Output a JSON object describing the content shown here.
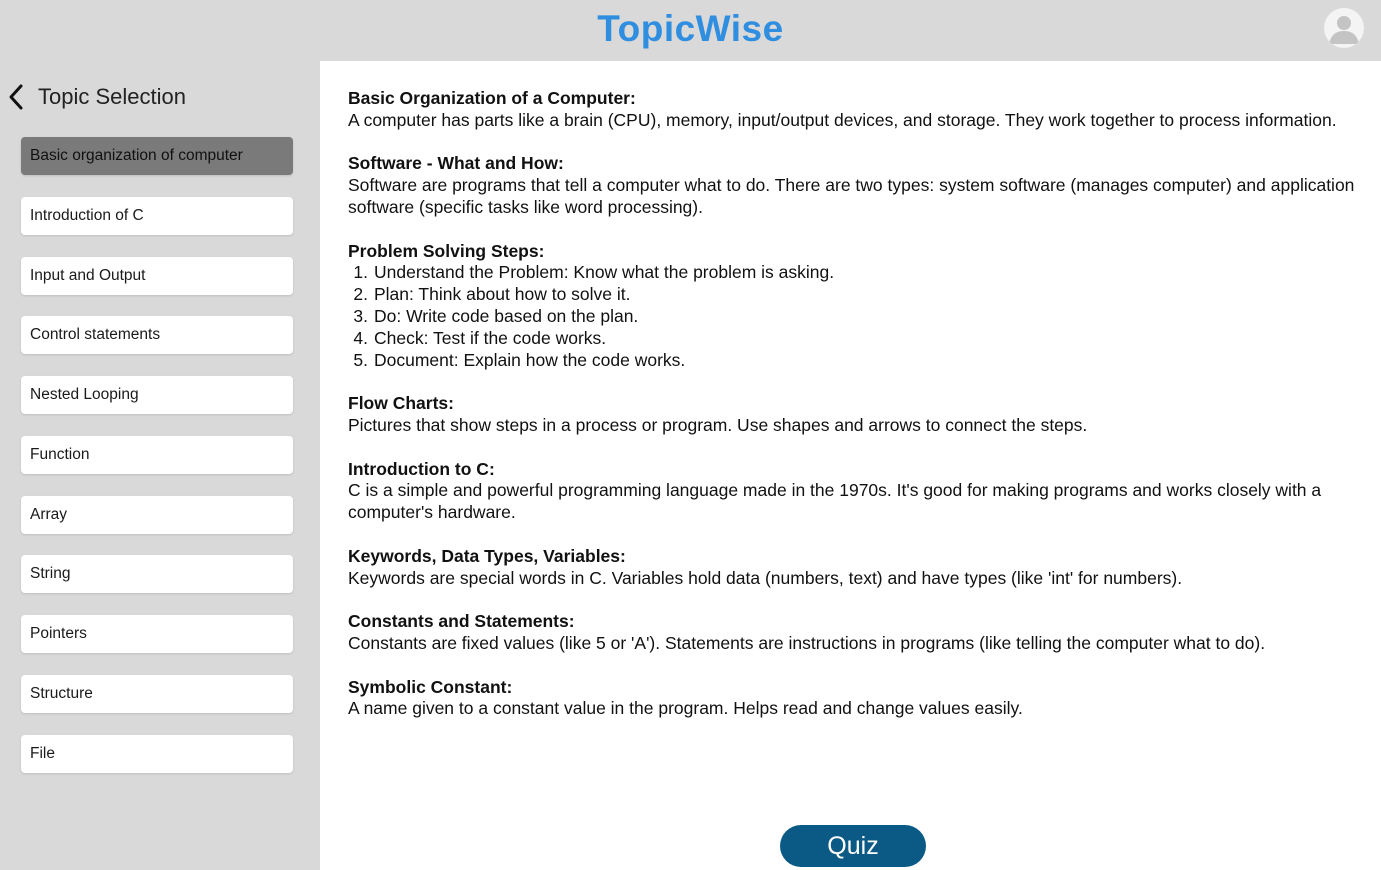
{
  "app": {
    "title": "TopicWise",
    "accent_color": "#2f8ee0",
    "avatar_icon": "user-avatar-icon"
  },
  "sidebar": {
    "back_icon": "chevron-left-icon",
    "title": "Topic Selection",
    "active_index": 0,
    "items": [
      {
        "label": "Basic organization of computer"
      },
      {
        "label": "Introduction of C"
      },
      {
        "label": "Input and Output"
      },
      {
        "label": "Control statements"
      },
      {
        "label": "Nested Looping"
      },
      {
        "label": "Function"
      },
      {
        "label": "Array"
      },
      {
        "label": "String"
      },
      {
        "label": "Pointers"
      },
      {
        "label": "Structure"
      },
      {
        "label": "File"
      }
    ]
  },
  "content": {
    "sections": [
      {
        "title": "Basic Organization of a Computer:",
        "body": "A computer has parts like a brain (CPU), memory, input/output devices, and storage. They work together to process information."
      },
      {
        "title": "Software - What and How:",
        "body": "Software are programs that tell a computer what to do. There are two types: system software (manages computer) and application software (specific tasks like word processing)."
      },
      {
        "title": "Problem Solving Steps:",
        "steps": [
          {
            "num": "1.",
            "text": "Understand the Problem: Know what the problem is asking."
          },
          {
            "num": "2.",
            "text": "Plan: Think about how to solve it."
          },
          {
            "num": "3.",
            "text": "Do: Write code based on the plan."
          },
          {
            "num": "4.",
            "text": "Check: Test if the code works."
          },
          {
            "num": "5.",
            "text": "Document: Explain how the code works."
          }
        ]
      },
      {
        "title": "Flow Charts:",
        "body": "Pictures that show steps in a process or program. Use shapes and arrows to connect the steps."
      },
      {
        "title": "Introduction to C:",
        "body": "C is a simple and powerful programming language made in the 1970s. It's good for making programs and works closely with a computer's hardware."
      },
      {
        "title": "Keywords, Data Types, Variables:",
        "body": "Keywords are special words in C. Variables hold data (numbers, text) and have types (like 'int' for numbers)."
      },
      {
        "title": "Constants and Statements:",
        "body": "Constants are fixed values (like 5 or 'A'). Statements are instructions in programs (like telling the computer what to do)."
      },
      {
        "title": "Symbolic Constant:",
        "body": "A name given to a constant value in the program. Helps read and change values easily."
      }
    ]
  },
  "quiz": {
    "label": "Quiz",
    "color": "#0b5a85"
  }
}
